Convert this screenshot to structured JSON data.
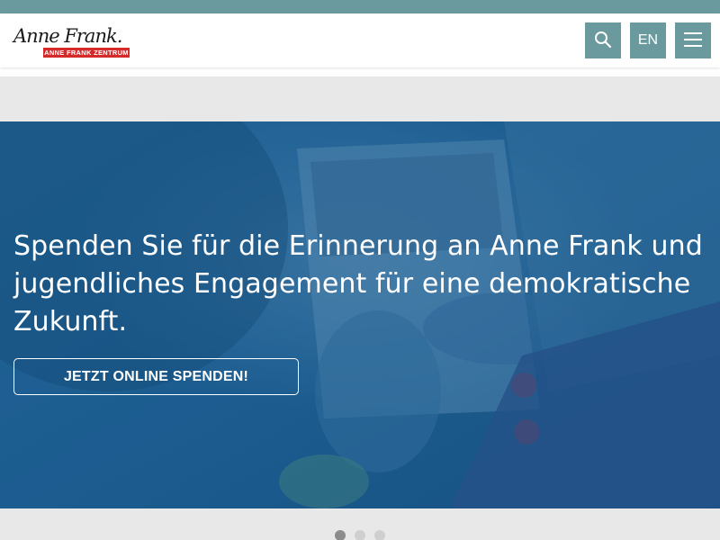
{
  "header": {
    "logo_signature": "Anne Frank.",
    "logo_tagline": "ANNE FRANK ZENTRUM",
    "search_icon": "search-icon",
    "language_label": "EN",
    "menu_icon": "hamburger-menu-icon"
  },
  "hero": {
    "headline": "Spenden Sie für die Erinnerung an Anne Frank und jugendliches Engagement für eine demokratische Zukunft.",
    "donate_label": "JETZT ONLINE SPENDEN!"
  },
  "carousel": {
    "total_slides": 3,
    "active_slide": 1
  },
  "colors": {
    "accent": "#6a9a9d",
    "hero_overlay": "#1c5a8a",
    "logo_red": "#d42a2a"
  }
}
